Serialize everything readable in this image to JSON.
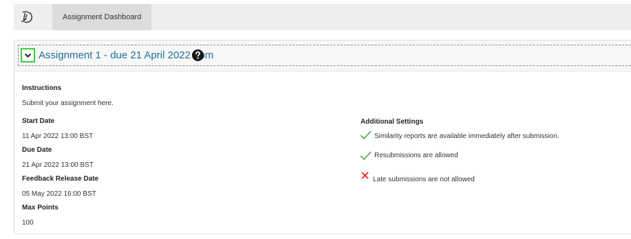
{
  "nav": {
    "tab_label": "Assignment Dashboard"
  },
  "assignment": {
    "title": "Assignment 1 - due 21 April 2022 1pm"
  },
  "instructions": {
    "label": "Instructions",
    "text": "Submit your assignment here."
  },
  "dates": {
    "start_label": "Start Date",
    "start_value": "11 Apr 2022 13:00 BST",
    "due_label": "Due Date",
    "due_value": "21 Apr 2022 13:00 BST",
    "feedback_label": "Feedback Release Date",
    "feedback_value": "05 May 2022 16:00 BST",
    "points_label": "Max Points",
    "points_value": "100"
  },
  "settings": {
    "title": "Additional Settings",
    "items": [
      {
        "icon": "check-icon",
        "text": "Similarity reports are available immediately after submission."
      },
      {
        "icon": "check-icon",
        "text": "Resubmissions are allowed"
      },
      {
        "icon": "cross-icon",
        "text": "Late submissions are not allowed"
      }
    ]
  },
  "colors": {
    "link": "#1f6f9a",
    "check": "#3aa83a",
    "cross": "#e02020",
    "focus": "#3ecb3e"
  }
}
